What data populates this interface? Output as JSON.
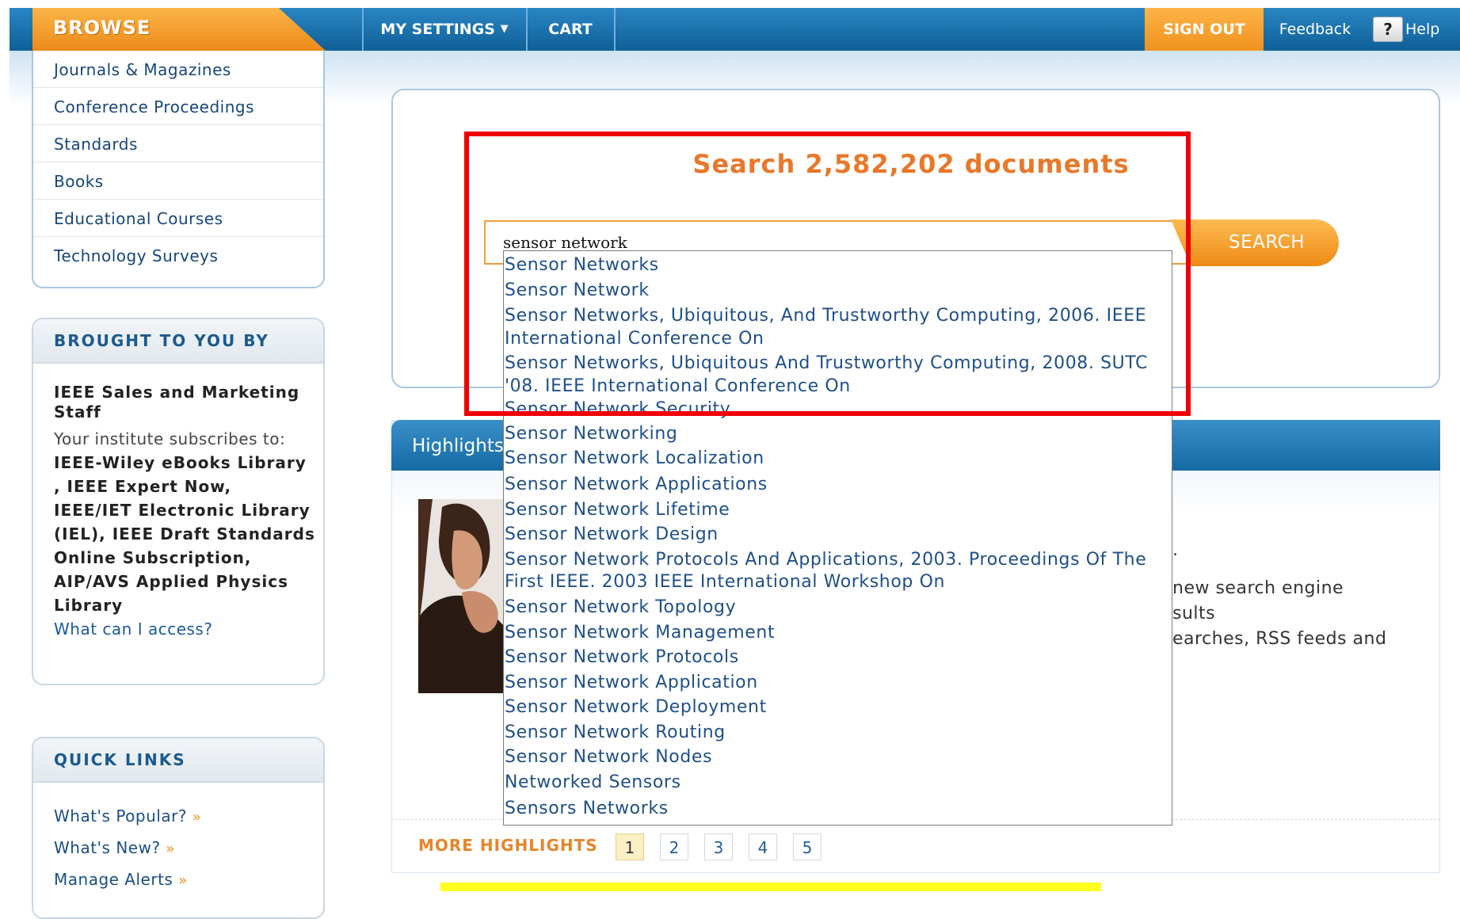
{
  "nav": {
    "browse": "BROWSE",
    "my_settings": "MY SETTINGS",
    "cart": "CART",
    "sign_out": "SIGN OUT",
    "feedback": "Feedback",
    "help_icon": "?",
    "help": "Help"
  },
  "browse_menu": [
    "Journals & Magazines",
    "Conference Proceedings",
    "Standards",
    "Books",
    "Educational Courses",
    "Technology Surveys"
  ],
  "brought_to_you": {
    "heading": "BROUGHT TO YOU BY",
    "org": "IEEE Sales and Marketing Staff",
    "subscribes_label": "Your institute subscribes to:",
    "subscriptions": "IEEE-Wiley eBooks Library , IEEE Expert Now, IEEE/IET Electronic Library (IEL), IEEE Draft Standards Online Subscription, AIP/AVS Applied Physics Library",
    "access_link": "What can I access?"
  },
  "quick_links": {
    "heading": "QUICK LINKS",
    "items": [
      "What's Popular?",
      "What's New?",
      "Manage Alerts"
    ],
    "arrow": "»"
  },
  "search": {
    "heading": "Search 2,582,202 documents",
    "query": "sensor network",
    "button": "SEARCH"
  },
  "autocomplete": [
    "Sensor Networks",
    "Sensor Network",
    "Sensor Networks, Ubiquitous, And Trustworthy Computing, 2006. IEEE",
    "International Conference On",
    "Sensor Networks, Ubiquitous And Trustworthy Computing, 2008. SUTC",
    "'08. IEEE International Conference On",
    "Sensor Network Security",
    "Sensor Networking",
    "Sensor Network Localization",
    "Sensor Network Applications",
    "Sensor Network Lifetime",
    "Sensor Network Design",
    "Sensor Network Protocols And Applications, 2003. Proceedings Of The",
    "First IEEE. 2003 IEEE International Workshop On",
    "Sensor Network Topology",
    "Sensor Network Management",
    "Sensor Network Protocols",
    "Sensor Network Application",
    "Sensor Network Deployment",
    "Sensor Network Routing",
    "Sensor Network Nodes",
    "Networked Sensors",
    "Sensors Networks"
  ],
  "highlights": {
    "tab": "Highlights",
    "fragments": [
      ".",
      "new search engine",
      "sults",
      "earches, RSS feeds and"
    ],
    "more_label": "MORE HIGHLIGHTS",
    "pages": [
      "1",
      "2",
      "3",
      "4",
      "5"
    ],
    "active_page": "1"
  },
  "colors": {
    "nav_blue": "#1a6fad",
    "accent_orange": "#f0921f",
    "link_blue": "#1e4f86",
    "annotation_red": "#ee0000",
    "highlight_yellow": "#ffff22"
  }
}
